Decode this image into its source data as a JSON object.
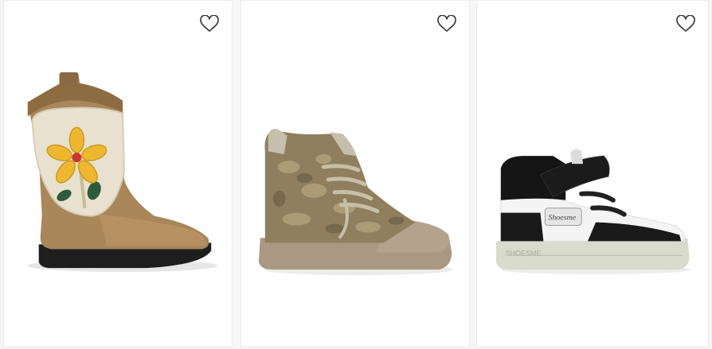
{
  "products": [
    {
      "name": "boot-cowboy",
      "favorite": false
    },
    {
      "name": "sneaker-velvet",
      "favorite": false
    },
    {
      "name": "sneaker-black-white",
      "brand_label": "SHOESME",
      "tongue_label": "Shoesme",
      "favorite": false
    }
  ],
  "icons": {
    "favorite": "heart-outline-icon"
  },
  "colors": {
    "page_bg": "#f6f6f6",
    "card_bg": "#ffffff",
    "icon_stroke": "#333333"
  }
}
